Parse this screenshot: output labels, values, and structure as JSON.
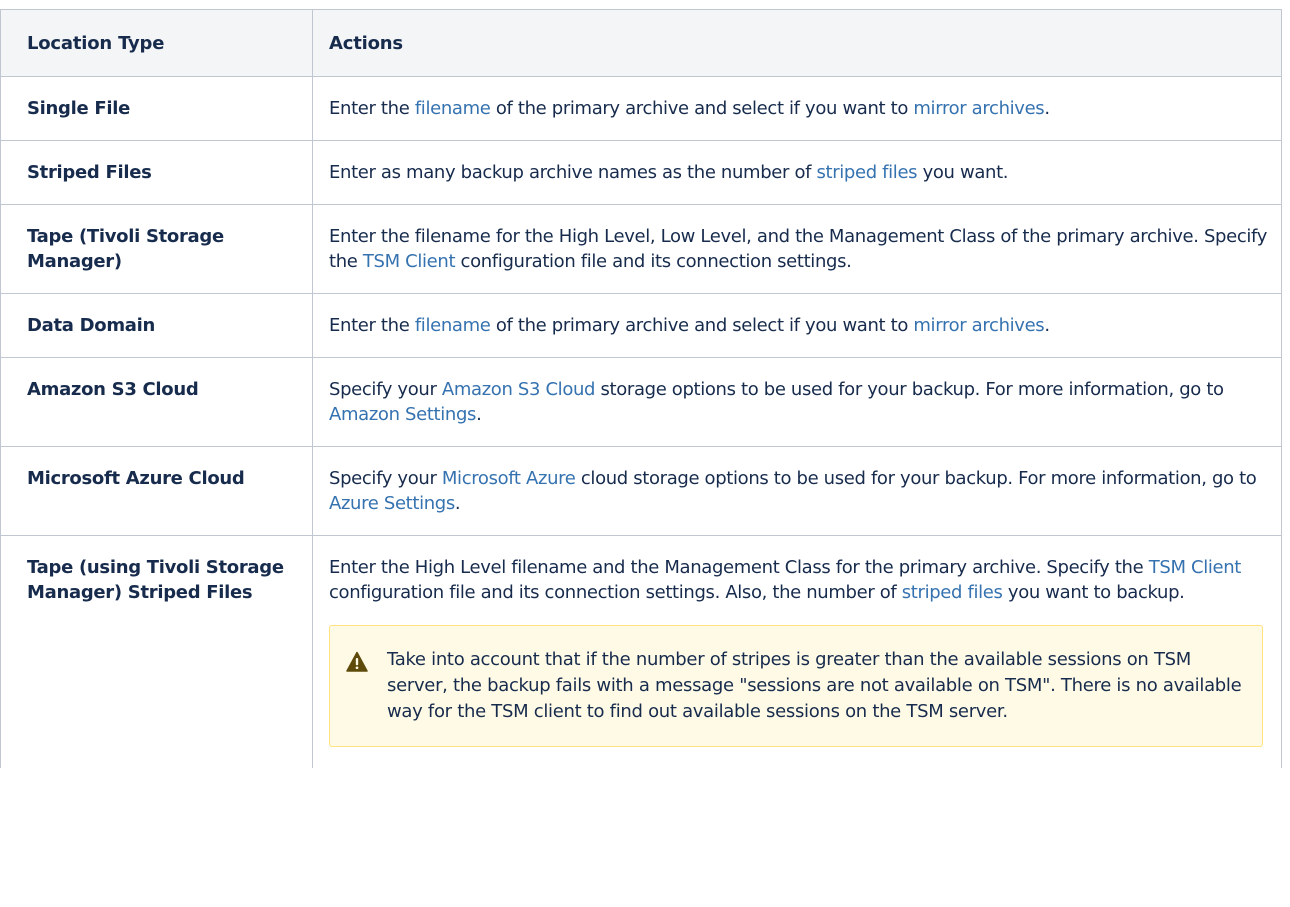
{
  "table": {
    "headers": [
      "Location Type",
      "Actions"
    ],
    "rows": [
      {
        "location": "Single File",
        "parts": [
          {
            "text": "Enter the "
          },
          {
            "link": "filename"
          },
          {
            "text": " of the primary archive and select if you want to "
          },
          {
            "link": "mirror archives"
          },
          {
            "text": "."
          }
        ]
      },
      {
        "location": "Striped Files",
        "parts": [
          {
            "text": "Enter as many backup archive names as the number of "
          },
          {
            "link": "striped files"
          },
          {
            "text": " you want."
          }
        ]
      },
      {
        "location": "Tape (Tivoli Storage Manager)",
        "parts": [
          {
            "text": "Enter the filename for the High Level, Low Level, and the Management Class of the primary archive. Specify the "
          },
          {
            "link": "TSM Client"
          },
          {
            "text": " configuration file and its connection settings."
          }
        ]
      },
      {
        "location": "Data Domain",
        "parts": [
          {
            "text": "Enter the "
          },
          {
            "link": "filename"
          },
          {
            "text": " of the primary archive and select if you want to "
          },
          {
            "link": "mirror archives"
          },
          {
            "text": "."
          }
        ]
      },
      {
        "location": "Amazon S3 Cloud",
        "parts": [
          {
            "text": "Specify your "
          },
          {
            "link": "Amazon S3 Cloud"
          },
          {
            "text": " storage options to be used for your backup. For more information, go to "
          },
          {
            "link": "Amazon Settings"
          },
          {
            "text": "."
          }
        ]
      },
      {
        "location": "Microsoft Azure Cloud",
        "parts": [
          {
            "text": "Specify your "
          },
          {
            "link": "Microsoft Azure"
          },
          {
            "text": " cloud storage options to be used for your backup. For more information, go to "
          },
          {
            "link": "Azure Settings"
          },
          {
            "text": "."
          }
        ]
      },
      {
        "location": "Tape (using Tivoli Storage Manager) Striped Files",
        "parts": [
          {
            "text": "Enter the High Level filename and the Management Class for the primary archive. Specify the "
          },
          {
            "link": "TSM Client"
          },
          {
            "text": " configuration file and its connection settings. Also, the number of "
          },
          {
            "link": "striped files"
          },
          {
            "text": " you want to backup."
          }
        ],
        "warning": "Take into account that if the number of stripes is greater than the available sessions on TSM server, the backup fails with a message \"sessions are not available on TSM\". There is no available way for the TSM client to find out available sessions on the TSM server."
      }
    ]
  },
  "icons": {
    "warning": "warning-triangle-icon"
  },
  "colors": {
    "link": "#3572b0",
    "header_bg": "#f4f5f7",
    "border": "#c1c7d0",
    "warning_bg": "#fffae6",
    "warning_border": "#ffe380",
    "warning_icon": "#5e4a0a",
    "text": "#172b4d"
  }
}
